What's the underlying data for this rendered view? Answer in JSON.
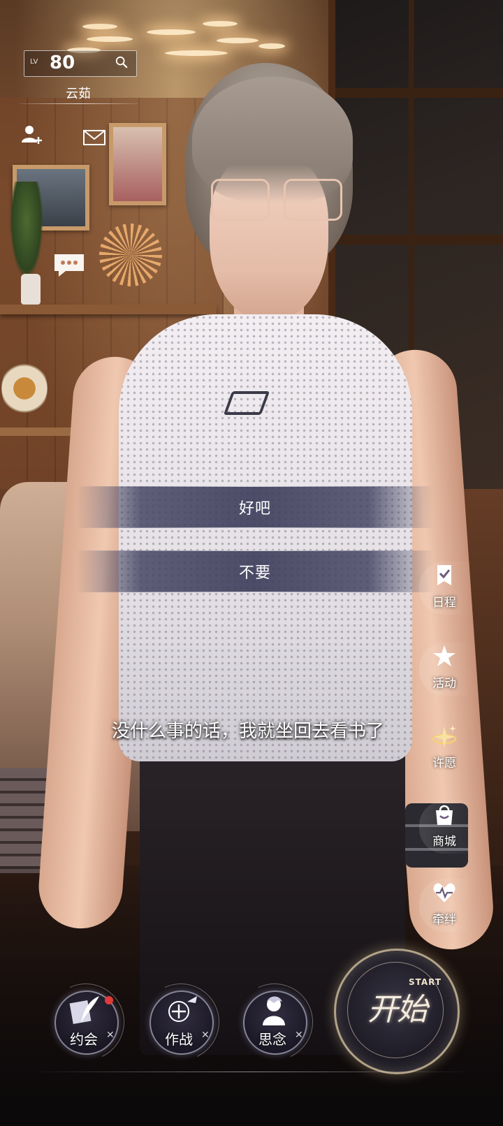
{
  "hud": {
    "level_tag": "LV",
    "level": "80",
    "player_name": "云茹"
  },
  "dialogue": {
    "choices": [
      "好吧",
      "不要"
    ],
    "subtitle": "没什么事的话，我就坐回去看书了"
  },
  "side_menu": [
    {
      "label": "日程",
      "icon": "schedule-icon"
    },
    {
      "label": "活动",
      "icon": "event-star-icon"
    },
    {
      "label": "许愿",
      "icon": "wish-sparkle-icon"
    },
    {
      "label": "商城",
      "icon": "shop-bag-icon"
    },
    {
      "label": "牵绊",
      "icon": "bond-heart-icon"
    }
  ],
  "bottom_nav": [
    {
      "label": "约会",
      "icon": "date-quill-icon",
      "badge": true
    },
    {
      "label": "作战",
      "icon": "battle-crosshair-icon"
    },
    {
      "label": "思念",
      "icon": "miss-silhouette-icon"
    }
  ],
  "start_button": {
    "cn": "开始",
    "en": "START"
  },
  "colors": {
    "choice_bg": "#3c3c5a",
    "badge": "#e03a3a",
    "start_border": "#e6d2aa"
  }
}
